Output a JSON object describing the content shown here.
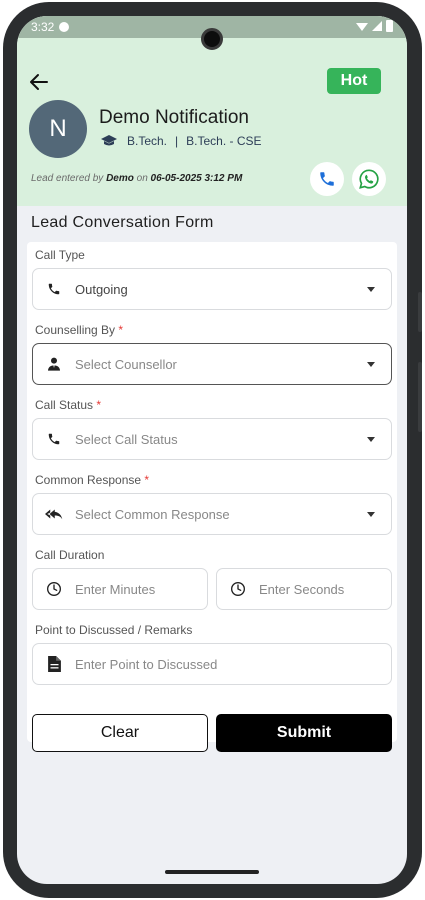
{
  "status_bar": {
    "time": "3:32"
  },
  "header": {
    "badge": "Hot",
    "avatar_initial": "N",
    "lead_name": "Demo Notification",
    "degree": "B.Tech.",
    "separator": "|",
    "branch": "B.Tech. - CSE",
    "entered_prefix": "Lead entered by",
    "entered_by": "Demo",
    "entered_on": "on",
    "entered_date": "06-05-2025 3:12 PM"
  },
  "form": {
    "title": "Lead Conversation Form",
    "call_type": {
      "label": "Call Type",
      "value": "Outgoing"
    },
    "counselling_by": {
      "label": "Counselling By",
      "required": "*",
      "placeholder": "Select Counsellor"
    },
    "call_status": {
      "label": "Call Status",
      "required": "*",
      "placeholder": "Select Call Status"
    },
    "common_response": {
      "label": "Common Response",
      "required": "*",
      "placeholder": "Select Common Response"
    },
    "call_duration": {
      "label": "Call Duration",
      "minutes_placeholder": "Enter Minutes",
      "seconds_placeholder": "Enter Seconds"
    },
    "remarks": {
      "label": "Point to Discussed / Remarks",
      "placeholder": "Enter Point to Discussed"
    },
    "clear_label": "Clear",
    "submit_label": "Submit"
  },
  "icons": {
    "back": "arrow-left-icon",
    "call": "phone-icon",
    "whatsapp": "whatsapp-icon",
    "graduation": "graduation-cap-icon",
    "counsellor": "person-icon",
    "response": "reply-all-icon",
    "clock": "clock-icon",
    "document": "document-icon"
  },
  "colors": {
    "header_bg": "#d9f0dd",
    "hot_badge": "#36b45a",
    "avatar_bg": "#536878",
    "call_icon": "#1e6fd9",
    "whatsapp_icon": "#25a244",
    "required": "#e53935"
  }
}
